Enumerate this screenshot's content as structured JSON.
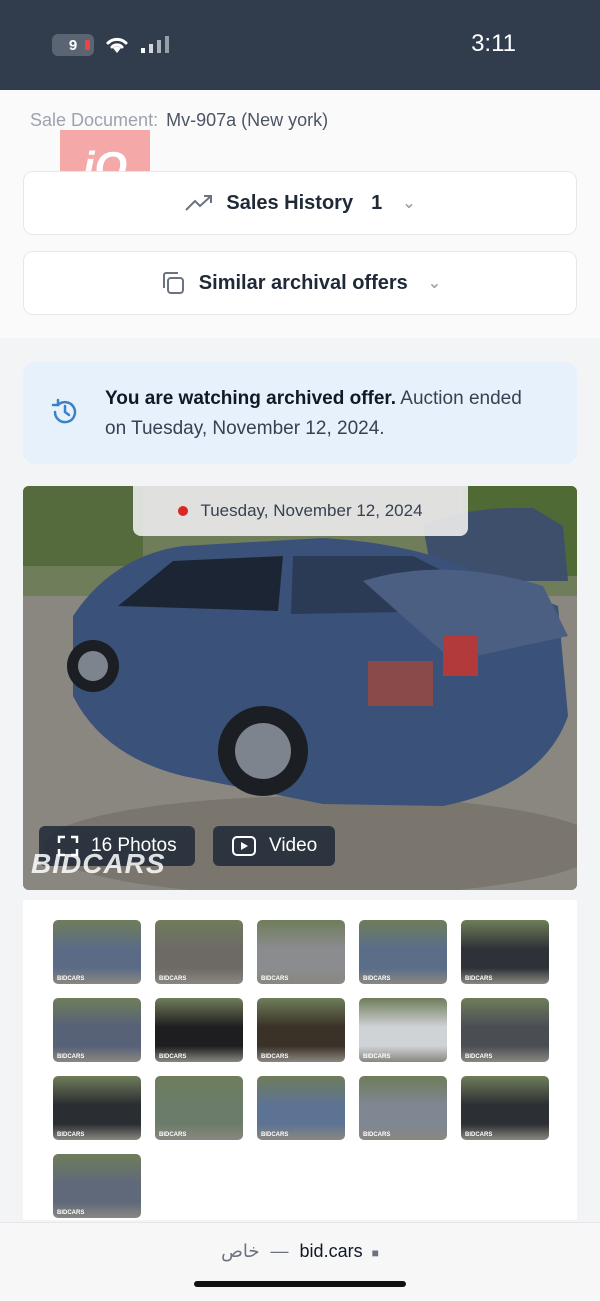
{
  "status": {
    "battery": "9",
    "time": "3:11"
  },
  "sale_document": {
    "label": "Sale Document:",
    "value": "Mv-907a (New york)"
  },
  "watermark_logo": "iQ",
  "sales_history": {
    "label": "Sales History",
    "count": "1"
  },
  "similar_offers": {
    "label": "Similar archival offers"
  },
  "notice": {
    "bold": "You are watching archived offer.",
    "rest": " Auction ended on Tuesday, November 12, 2024."
  },
  "photo": {
    "date": "Tuesday, November 12, 2024",
    "photos_label": "16 Photos",
    "video_label": "Video",
    "watermark": "BIDCARS"
  },
  "thumbnails": [
    {
      "color": "#5b6b86"
    },
    {
      "color": "#6d6a66"
    },
    {
      "color": "#8a8c90"
    },
    {
      "color": "#5a6e8a"
    },
    {
      "color": "#2e3238"
    },
    {
      "color": "#576178"
    },
    {
      "color": "#1e1e20"
    },
    {
      "color": "#3a3228"
    },
    {
      "color": "#cfd2d6"
    },
    {
      "color": "#4a4e54"
    },
    {
      "color": "#2a2d31"
    },
    {
      "color": "#6b7d6a"
    },
    {
      "color": "#5d7394"
    },
    {
      "color": "#7e8792"
    },
    {
      "color": "#2c2f33"
    },
    {
      "color": "#60697a"
    }
  ],
  "thumb_badge": "BIDCARS",
  "browser": {
    "private": "خاص",
    "sep": "—",
    "domain": "bid.cars"
  }
}
